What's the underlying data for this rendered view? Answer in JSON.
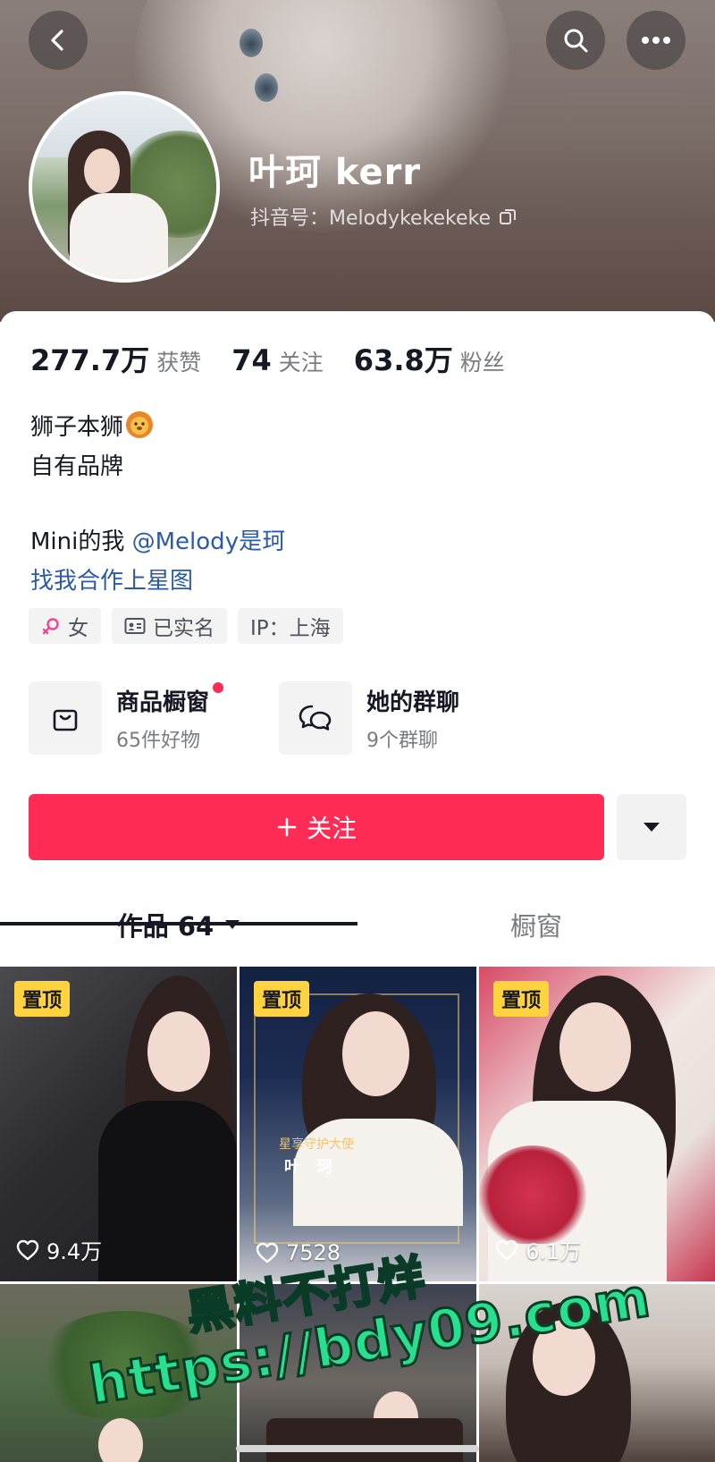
{
  "header": {
    "nickname": "叶珂 kerr",
    "douyin_id": "抖音号：Melodykekekeke"
  },
  "stats": [
    {
      "value": "277.7万",
      "label": "获赞"
    },
    {
      "value": "74",
      "label": "关注"
    },
    {
      "value": "63.8万",
      "label": "粉丝"
    }
  ],
  "bio": {
    "line1": "狮子本狮",
    "line2": "自有品牌",
    "line3_prefix": "Mini的我 ",
    "line3_mention": "@Melody是珂",
    "line4": "找我合作上星图"
  },
  "tags": {
    "gender": "女",
    "verified": "已实名",
    "ip": "IP：上海"
  },
  "features": {
    "shop_title": "商品橱窗",
    "shop_sub": "65件好物",
    "group_title": "她的群聊",
    "group_sub": "9个群聊"
  },
  "actions": {
    "follow": "关注"
  },
  "tabs": {
    "works": "作品 64",
    "window": "橱窗"
  },
  "videos": [
    {
      "pinned": "置顶",
      "likes": "9.4万"
    },
    {
      "pinned": "置顶",
      "likes": "7528",
      "overlay_line1": "星享守护大使",
      "overlay_line2": "叶 珂"
    },
    {
      "pinned": "置顶",
      "likes": "6.1万"
    }
  ],
  "watermark": {
    "line1": "黑料不打烊",
    "line2": "https://bdy09.com"
  },
  "colors": {
    "accent": "#fe2c55",
    "link": "#2a5aa8",
    "pin": "#ffd23f",
    "watermark": "#27e08f"
  }
}
